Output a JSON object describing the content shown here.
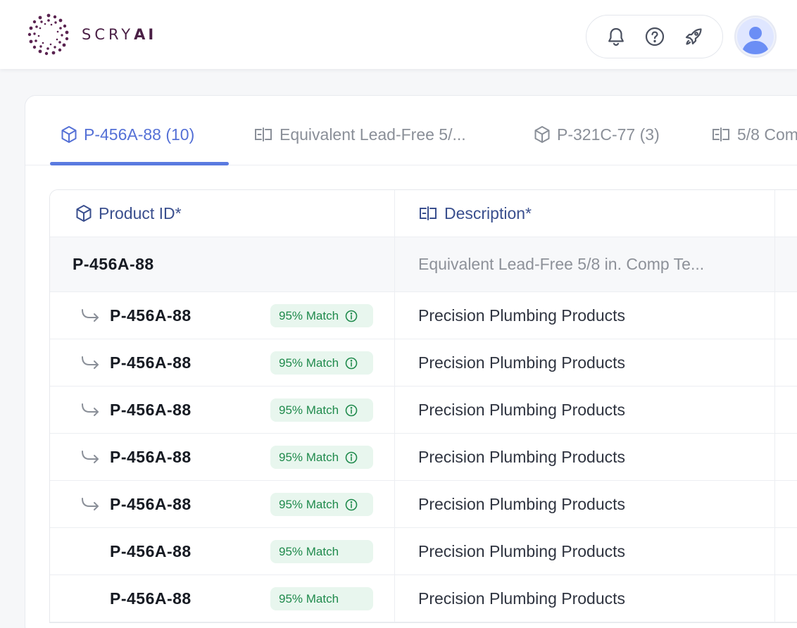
{
  "brand": {
    "name_main": "SCRY",
    "name_accent": "AI",
    "color": "#4a1f45"
  },
  "header": {
    "actions": [
      {
        "icon": "bell-icon"
      },
      {
        "icon": "help-circle-icon"
      },
      {
        "icon": "rocket-icon"
      }
    ],
    "avatar_icon": "user-avatar-icon"
  },
  "tabs": [
    {
      "label": "P-456A-88 (10)",
      "icon": "cube-icon",
      "active": true
    },
    {
      "label": "Equivalent Lead-Free 5/...",
      "icon": "text-field-icon",
      "active": false
    },
    {
      "label": "P-321C-77 (3)",
      "icon": "cube-icon",
      "active": false
    },
    {
      "label": "5/8 Com",
      "icon": "text-field-icon",
      "active": false
    }
  ],
  "table": {
    "columns": [
      {
        "label": "Product ID*",
        "icon": "cube-icon"
      },
      {
        "label": "Description*",
        "icon": "text-field-icon"
      }
    ],
    "parent": {
      "id": "P-456A-88",
      "description": "Equivalent Lead-Free 5/8 in. Comp Te..."
    },
    "rows": [
      {
        "id": "P-456A-88",
        "match": "95% Match",
        "description": "Precision Plumbing Products",
        "has_arrow": true,
        "has_info": true
      },
      {
        "id": "P-456A-88",
        "match": "95% Match",
        "description": "Precision Plumbing Products",
        "has_arrow": true,
        "has_info": true
      },
      {
        "id": "P-456A-88",
        "match": "95% Match",
        "description": "Precision Plumbing Products",
        "has_arrow": true,
        "has_info": true
      },
      {
        "id": "P-456A-88",
        "match": "95% Match",
        "description": "Precision Plumbing Products",
        "has_arrow": true,
        "has_info": true
      },
      {
        "id": "P-456A-88",
        "match": "95% Match",
        "description": "Precision Plumbing Products",
        "has_arrow": true,
        "has_info": true
      },
      {
        "id": "P-456A-88",
        "match": "95% Match",
        "description": "Precision Plumbing Products",
        "has_arrow": false,
        "has_info": false
      },
      {
        "id": "P-456A-88",
        "match": "95% Match",
        "description": "Precision Plumbing Products",
        "has_arrow": false,
        "has_info": false
      }
    ]
  },
  "colors": {
    "accent": "#5a7ae0",
    "match_bg": "#e8f6ee",
    "match_text": "#1f8a4c"
  }
}
